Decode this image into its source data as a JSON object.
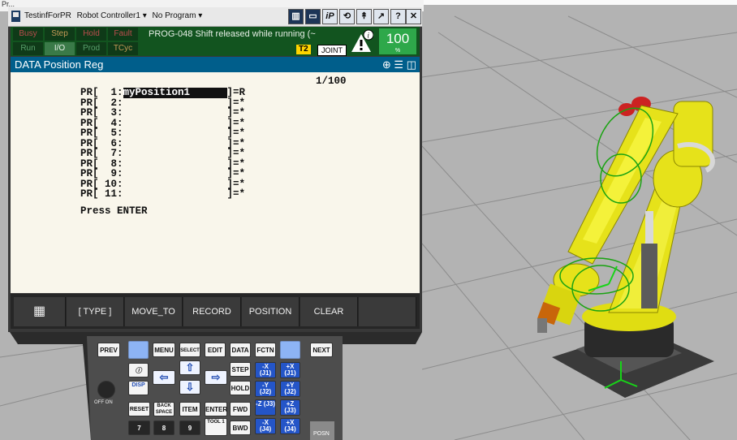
{
  "host_window": {
    "menu_text": "Pr..."
  },
  "titlebar": {
    "items": [
      "TestinfForPR",
      "Robot Controller1 ▾",
      "No Program ▾"
    ],
    "buttons": [
      "▥",
      "▭",
      "iP",
      "⟲",
      "↟",
      "↗",
      "?",
      "✕"
    ]
  },
  "status": {
    "indicators": [
      {
        "label": "Busy",
        "state": "off"
      },
      {
        "label": "Step",
        "state": "off"
      },
      {
        "label": "Hold",
        "state": "off"
      },
      {
        "label": "Fault",
        "state": "off"
      },
      {
        "label": "Run",
        "state": "off"
      },
      {
        "label": "I/O",
        "state": "on"
      },
      {
        "label": "Prod",
        "state": "off"
      },
      {
        "label": "TCyc",
        "state": "off"
      }
    ],
    "alarm_text": "PROG-048 Shift released while running (~",
    "mode": "T2",
    "coord": "JOINT",
    "override": "100",
    "override_unit": "%"
  },
  "screen": {
    "title": "DATA Position Reg",
    "page": "1/100",
    "rows": [
      {
        "idx": "PR[  1:",
        "comment": "myPosition1",
        "val": "]=R"
      },
      {
        "idx": "PR[  2:",
        "comment": "",
        "val": "]=*"
      },
      {
        "idx": "PR[  3:",
        "comment": "",
        "val": "]=*"
      },
      {
        "idx": "PR[  4:",
        "comment": "",
        "val": "]=*"
      },
      {
        "idx": "PR[  5:",
        "comment": "",
        "val": "]=*"
      },
      {
        "idx": "PR[  6:",
        "comment": "",
        "val": "]=*"
      },
      {
        "idx": "PR[  7:",
        "comment": "",
        "val": "]=*"
      },
      {
        "idx": "PR[  8:",
        "comment": "",
        "val": "]=*"
      },
      {
        "idx": "PR[  9:",
        "comment": "",
        "val": "]=*"
      },
      {
        "idx": "PR[ 10:",
        "comment": "",
        "val": "]=*"
      },
      {
        "idx": "PR[ 11:",
        "comment": "",
        "val": "]=*"
      }
    ],
    "prompt": "Press ENTER"
  },
  "function_keys": [
    "",
    "[ TYPE ]",
    "MOVE_TO",
    "RECORD",
    "POSITION",
    "CLEAR",
    ""
  ],
  "keypad": {
    "row1": [
      "PREV",
      "",
      "MENU",
      "SELECT",
      "EDIT",
      "DATA",
      "FCTN",
      "",
      "NEXT"
    ],
    "info": "ⓘ",
    "disp": "DISP",
    "step": "STEP",
    "hold": "HOLD",
    "fwd": "FWD",
    "bwd": "BWD",
    "reset": "RESET",
    "backspace": "BACK SPACE",
    "item": "ITEM",
    "enter": "ENTER",
    "tool1": "TOOL 1",
    "num": [
      "7",
      "8",
      "9"
    ],
    "jog": [
      "-X (J1)",
      "+X (J1)",
      "-Y (J2)",
      "+Y (J2)",
      "-Z (J3)",
      "+Z (J3)",
      "-X (J4)",
      "+X (J4)"
    ],
    "posn": "POSN",
    "offon": "OFF ON"
  }
}
